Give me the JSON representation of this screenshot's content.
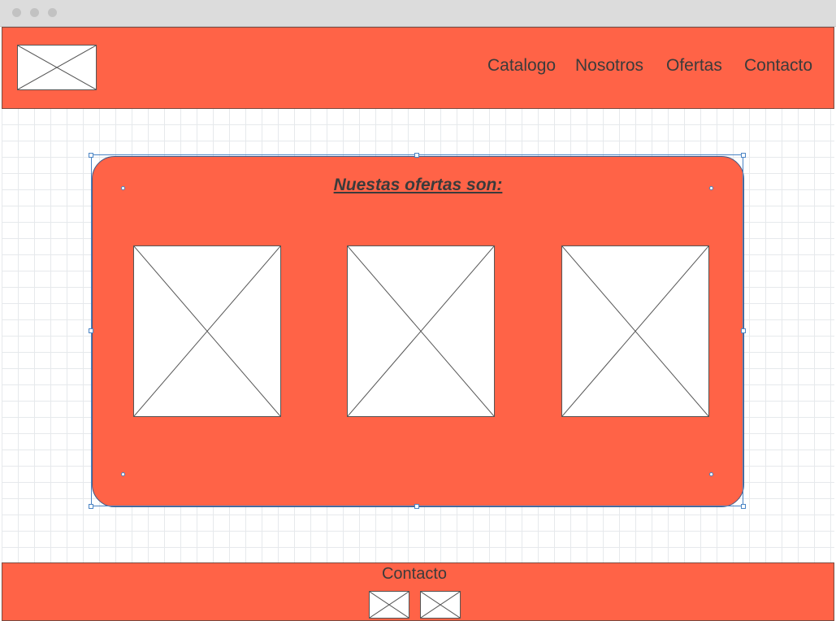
{
  "window": {
    "controls": [
      "close",
      "minimize",
      "maximize"
    ]
  },
  "header": {
    "logo_icon": "image-placeholder-icon",
    "nav": [
      {
        "label": "Catalogo"
      },
      {
        "label": "Nosotros"
      },
      {
        "label": "Ofertas"
      },
      {
        "label": "Contacto"
      }
    ]
  },
  "offers": {
    "heading": "Nuestas ofertas son:",
    "items": [
      {
        "icon": "image-placeholder-icon"
      },
      {
        "icon": "image-placeholder-icon"
      },
      {
        "icon": "image-placeholder-icon"
      }
    ]
  },
  "footer": {
    "title": "Contacto",
    "icons": [
      "image-placeholder-icon",
      "image-placeholder-icon"
    ]
  },
  "colors": {
    "accent": "#ff6347",
    "text": "#3b3b3b",
    "selection": "#4a84c4",
    "grid": "#e6e9ec"
  }
}
